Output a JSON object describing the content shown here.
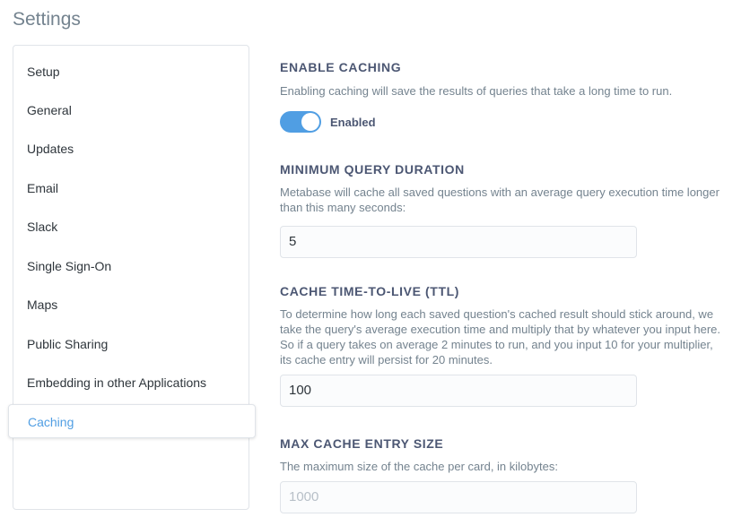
{
  "page": {
    "title": "Settings"
  },
  "sidebar": {
    "items": [
      {
        "label": "Setup"
      },
      {
        "label": "General"
      },
      {
        "label": "Updates"
      },
      {
        "label": "Email"
      },
      {
        "label": "Slack"
      },
      {
        "label": "Single Sign-On"
      },
      {
        "label": "Maps"
      },
      {
        "label": "Public Sharing"
      },
      {
        "label": "Embedding in other Applications"
      },
      {
        "label": "Caching",
        "active": true
      }
    ]
  },
  "colors": {
    "accent": "#509ee3",
    "heading": "#4c5773",
    "muted": "#74838f",
    "border": "#e0e4e9"
  },
  "sections": {
    "enable_caching": {
      "heading": "ENABLE CACHING",
      "description": "Enabling caching will save the results of queries that take a long time to run.",
      "toggle_state": true,
      "toggle_label": "Enabled"
    },
    "min_duration": {
      "heading": "MINIMUM QUERY DURATION",
      "description": "Metabase will cache all saved questions with an average query execution time longer than this many seconds:",
      "value": "5"
    },
    "ttl": {
      "heading": "CACHE TIME-TO-LIVE (TTL)",
      "description": "To determine how long each saved question's cached result should stick around, we take the query's average execution time and multiply that by whatever you input here. So if a query takes on average 2 minutes to run, and you input 10 for your multiplier, its cache entry will persist for 20 minutes.",
      "value": "100"
    },
    "max_size": {
      "heading": "MAX CACHE ENTRY SIZE",
      "description": "The maximum size of the cache per card, in kilobytes:",
      "value": "",
      "placeholder": "1000"
    }
  }
}
